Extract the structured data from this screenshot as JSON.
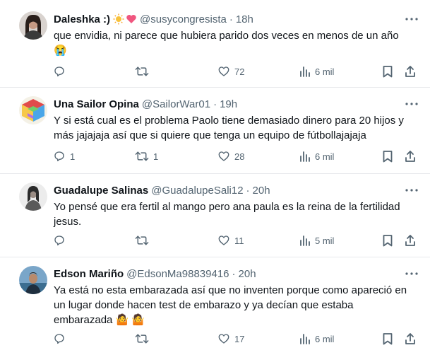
{
  "tweets": [
    {
      "name": "Daleshka :)",
      "handle": "@susycongresista",
      "time": "18h",
      "text_lines": [
        "que envidia, ni parece que hubiera parido dos veces en menos de un año",
        "😭"
      ],
      "replies": "",
      "retweets": "",
      "likes": "72",
      "views": "6 mil"
    },
    {
      "name": "Una Sailor Opina",
      "handle": "@SailorWar01",
      "time": "19h",
      "text_lines": [
        "Y si está cual es el problema Paolo tiene demasiado dinero para 20 hijos y",
        "más jajajaja así que si quiere que tenga un equipo de fútbollajajaja"
      ],
      "replies": "1",
      "retweets": "1",
      "likes": "28",
      "views": "6 mil"
    },
    {
      "name": "Guadalupe Salinas",
      "handle": "@GuadalupeSali12",
      "time": "20h",
      "text_lines": [
        "Yo pensé que era fertil al mango pero ana paula es la reina de la fertilidad",
        "jesus."
      ],
      "replies": "",
      "retweets": "",
      "likes": "11",
      "views": "5 mil"
    },
    {
      "name": "Edson Mariño",
      "handle": "@EdsonMa98839416",
      "time": "20h",
      "text_lines": [
        "Ya está no esta embarazada así que no inventen porque como apareció en",
        "un lugar donde hacen test de embarazo y ya decían que estaba",
        "embarazada 🤷 🤷"
      ],
      "replies": "",
      "retweets": "",
      "likes": "17",
      "views": "6 mil"
    }
  ],
  "icons": {
    "reply": "reply-icon",
    "retweet": "retweet-icon",
    "like": "heart-icon",
    "views": "views-icon",
    "bookmark": "bookmark-icon",
    "share": "share-icon",
    "more": "more-icon"
  },
  "colors": {
    "text": "#0f1419",
    "secondary": "#536471",
    "divider": "#e7e9ec"
  }
}
